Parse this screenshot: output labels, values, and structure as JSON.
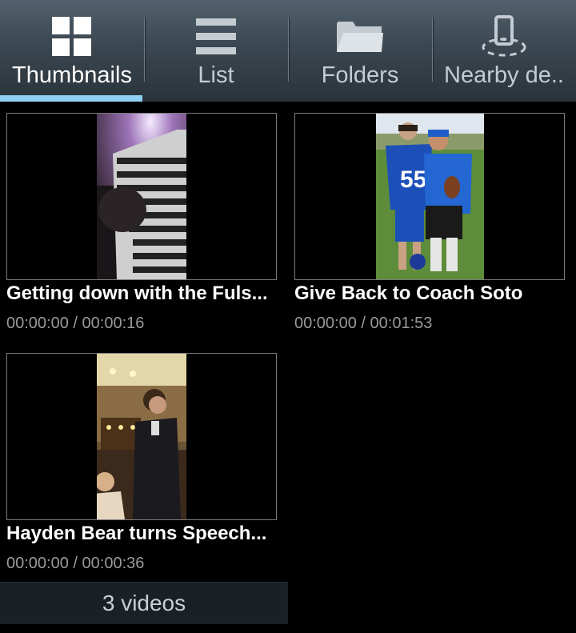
{
  "tabs": [
    {
      "label": "Thumbnails",
      "icon": "grid-icon",
      "active": true
    },
    {
      "label": "List",
      "icon": "list-icon",
      "active": false
    },
    {
      "label": "Folders",
      "icon": "folder-icon",
      "active": false
    },
    {
      "label": "Nearby de..",
      "icon": "nearby-device-icon",
      "active": false
    }
  ],
  "videos": [
    {
      "title": "Getting down with the Fuls...",
      "time": "00:00:00 / 00:00:16"
    },
    {
      "title": "Give Back to Coach Soto",
      "time": "00:00:00 / 00:01:53"
    },
    {
      "title": "Hayden Bear turns Speech...",
      "time": "00:00:00 / 00:00:36"
    }
  ],
  "footer": {
    "count_label": "3 videos"
  },
  "colors": {
    "tab_indicator": "#8fd0f2",
    "tabbar_top": "#52616d",
    "background": "#000000"
  }
}
